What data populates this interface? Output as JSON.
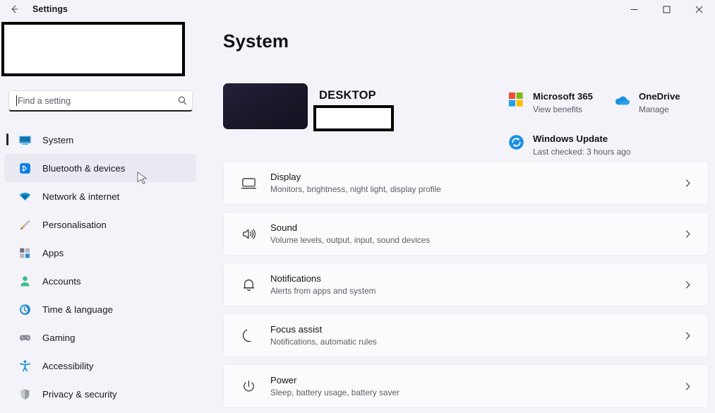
{
  "window": {
    "title": "Settings",
    "back_icon": "back-arrow-icon",
    "minimize_label": "–",
    "maximize_label": "□",
    "close_label": "×"
  },
  "sidebar": {
    "profile_redacted": true,
    "search": {
      "placeholder": "Find a setting",
      "value": "",
      "icon": "search-icon"
    },
    "items": [
      {
        "label": "System",
        "icon": "monitor-icon",
        "selected": true,
        "hovered": false
      },
      {
        "label": "Bluetooth & devices",
        "icon": "bluetooth-icon",
        "selected": false,
        "hovered": true
      },
      {
        "label": "Network & internet",
        "icon": "wifi-icon",
        "selected": false,
        "hovered": false
      },
      {
        "label": "Personalisation",
        "icon": "paintbrush-icon",
        "selected": false,
        "hovered": false
      },
      {
        "label": "Apps",
        "icon": "apps-grid-icon",
        "selected": false,
        "hovered": false
      },
      {
        "label": "Accounts",
        "icon": "person-icon",
        "selected": false,
        "hovered": false
      },
      {
        "label": "Time & language",
        "icon": "clock-globe-icon",
        "selected": false,
        "hovered": false
      },
      {
        "label": "Gaming",
        "icon": "gamepad-icon",
        "selected": false,
        "hovered": false
      },
      {
        "label": "Accessibility",
        "icon": "accessibility-icon",
        "selected": false,
        "hovered": false
      },
      {
        "label": "Privacy & security",
        "icon": "shield-icon",
        "selected": false,
        "hovered": false
      }
    ]
  },
  "main": {
    "page_title": "System",
    "device": {
      "name": "DESKTOP",
      "model_redacted": true,
      "thumbnail": "device-thumbnail"
    },
    "services": [
      {
        "title": "Microsoft 365",
        "subtitle": "View benefits",
        "icon": "microsoft-365-logo"
      },
      {
        "title": "OneDrive",
        "subtitle": "Manage",
        "icon": "onedrive-cloud-icon"
      },
      {
        "title": "Windows Update",
        "subtitle": "Last checked: 3 hours ago",
        "icon": "windows-update-icon"
      }
    ],
    "settings_rows": [
      {
        "title": "Display",
        "subtitle": "Monitors, brightness, night light, display profile",
        "icon": "display-monitor-icon"
      },
      {
        "title": "Sound",
        "subtitle": "Volume levels, output, input, sound devices",
        "icon": "speaker-icon"
      },
      {
        "title": "Notifications",
        "subtitle": "Alerts from apps and system",
        "icon": "bell-icon"
      },
      {
        "title": "Focus assist",
        "subtitle": "Notifications, automatic rules",
        "icon": "moon-icon"
      },
      {
        "title": "Power",
        "subtitle": "Sleep, battery usage, battery saver",
        "icon": "power-icon"
      }
    ]
  },
  "colors": {
    "background": "#f3f3f9",
    "card": "#fbfbfd",
    "accent_bluetooth": "#0b7ee3",
    "accent_selection": "#22222b",
    "text_primary": "#14141a",
    "text_secondary": "#5c5c66"
  }
}
